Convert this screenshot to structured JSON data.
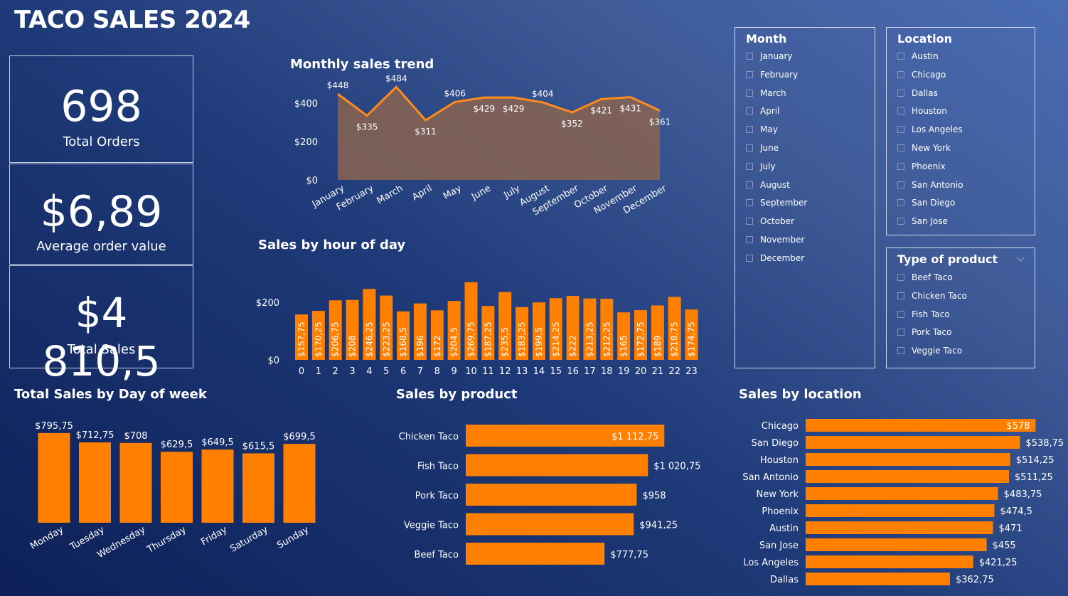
{
  "dashboard": {
    "title": "TACO SALES 2024"
  },
  "kpis": {
    "total_orders": {
      "value": "698",
      "label": "Total Orders"
    },
    "avg_order": {
      "value": "$6,89",
      "label": "Average order value"
    },
    "total_sales": {
      "value": "$4 810,5",
      "label": "Total Sales"
    }
  },
  "slicers": {
    "month": {
      "title": "Month",
      "items": [
        "January",
        "February",
        "March",
        "April",
        "May",
        "June",
        "July",
        "August",
        "September",
        "October",
        "November",
        "December"
      ]
    },
    "location": {
      "title": "Location",
      "items": [
        "Austin",
        "Chicago",
        "Dallas",
        "Houston",
        "Los Angeles",
        "New York",
        "Phoenix",
        "San Antonio",
        "San Diego",
        "San Jose"
      ]
    },
    "product_type": {
      "title": "Type of product",
      "items": [
        "Beef Taco",
        "Chicken Taco",
        "Fish Taco",
        "Pork Taco",
        "Veggie Taco"
      ]
    }
  },
  "colors": {
    "bar": "#ff8000",
    "area_fill": "#8a6450",
    "line": "#ff8c1a"
  },
  "chart_data": [
    {
      "id": "monthly",
      "type": "area",
      "title": "Monthly sales trend",
      "categories": [
        "January",
        "February",
        "March",
        "April",
        "May",
        "June",
        "July",
        "August",
        "September",
        "October",
        "November",
        "December"
      ],
      "values": [
        448,
        335,
        484,
        311,
        406,
        429,
        429,
        404,
        352,
        421,
        431,
        361
      ],
      "labels": [
        "$448",
        "$335",
        "$484",
        "$311",
        "$406",
        "$429",
        "$429",
        "$404",
        "$352",
        "$421",
        "$431",
        "$361"
      ],
      "y_ticks": [
        "$0",
        "$200",
        "$400"
      ],
      "ylim": [
        0,
        500
      ]
    },
    {
      "id": "hourly",
      "type": "bar",
      "title": "Sales by hour of day",
      "categories": [
        "0",
        "1",
        "2",
        "3",
        "4",
        "5",
        "6",
        "7",
        "8",
        "9",
        "10",
        "11",
        "12",
        "13",
        "14",
        "15",
        "16",
        "17",
        "18",
        "19",
        "20",
        "21",
        "22",
        "23"
      ],
      "values": [
        157.75,
        170.25,
        206.75,
        208,
        246.25,
        223.25,
        168.5,
        196,
        172,
        204.5,
        269.75,
        187.25,
        235.5,
        183.25,
        199.5,
        214.25,
        222,
        213.25,
        212.25,
        165,
        172.75,
        189,
        218.75,
        174.75
      ],
      "labels": [
        "$157,75",
        "$170,25",
        "$206,75",
        "$208",
        "$246,25",
        "$223,25",
        "$168,5",
        "$196",
        "$172",
        "$204,5",
        "$269,75",
        "$187,25",
        "$235,5",
        "$183,25",
        "$199,5",
        "$214,25",
        "$222",
        "$213,25",
        "$212,25",
        "$165",
        "$172,75",
        "$189",
        "$218,75",
        "$174,75"
      ],
      "y_ticks": [
        "$0",
        "$200"
      ],
      "ylim": [
        0,
        280
      ]
    },
    {
      "id": "weekday",
      "type": "bar",
      "title": "Total Sales by Day of week",
      "categories": [
        "Monday",
        "Tuesday",
        "Wednesday",
        "Thursday",
        "Friday",
        "Saturday",
        "Sunday"
      ],
      "values": [
        795.75,
        712.75,
        708,
        629.5,
        649.5,
        615.5,
        699.5
      ],
      "labels": [
        "$795,75",
        "$712,75",
        "$708",
        "$629,5",
        "$649,5",
        "$615,5",
        "$699,5"
      ]
    },
    {
      "id": "product",
      "type": "bar",
      "orientation": "horizontal",
      "title": "Sales by product",
      "categories": [
        "Chicken Taco",
        "Fish Taco",
        "Pork Taco",
        "Veggie Taco",
        "Beef Taco"
      ],
      "values": [
        1112.75,
        1020.75,
        958,
        941.25,
        777.75
      ],
      "labels": [
        "$1 112,75",
        "$1 020,75",
        "$958",
        "$941,25",
        "$777,75"
      ]
    },
    {
      "id": "location",
      "type": "bar",
      "orientation": "horizontal",
      "title": "Sales by location",
      "categories": [
        "Chicago",
        "San Diego",
        "Houston",
        "San Antonio",
        "New York",
        "Phoenix",
        "Austin",
        "San Jose",
        "Los Angeles",
        "Dallas"
      ],
      "values": [
        578,
        538.75,
        514.25,
        511.25,
        483.75,
        474.5,
        471,
        455,
        421.25,
        362.75
      ],
      "labels": [
        "$578",
        "$538,75",
        "$514,25",
        "$511,25",
        "$483,75",
        "$474,5",
        "$471",
        "$455",
        "$421,25",
        "$362,75"
      ]
    }
  ]
}
